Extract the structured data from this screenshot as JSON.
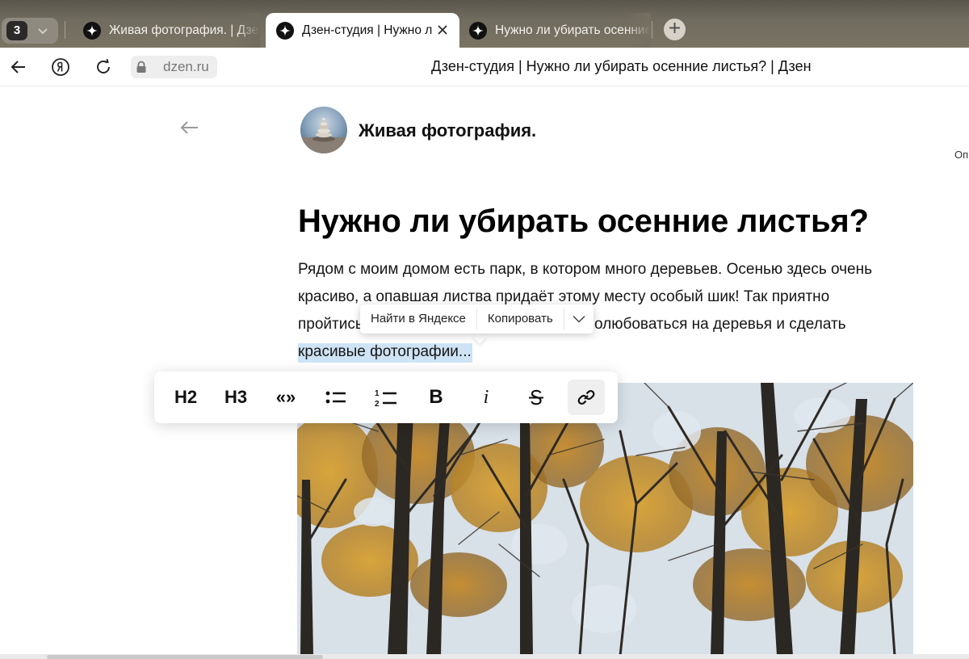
{
  "browser": {
    "tab_count": "3",
    "tabs": [
      {
        "title": "Живая фотография. | Дзен"
      },
      {
        "title": "Дзен-студия | Нужно ли убирать осенние листья? | Дзен"
      },
      {
        "title": "Нужно ли убирать осенние листья?"
      }
    ],
    "url": "dzen.ru",
    "page_title": "Дзен-студия | Нужно ли убирать осенние листья? | Дзен",
    "icons": [
      "back-arrow-icon",
      "yandex-logo-icon",
      "reload-icon",
      "lock-icon",
      "plus-icon",
      "close-icon",
      "zen-star-icon"
    ]
  },
  "editor": {
    "channel_name": "Живая фотография.",
    "side_text": "Оп",
    "headline": "Нужно ли убирать осенние листья?",
    "paragraph": {
      "line1": "Рядом с моим домом есть парк, в котором много деревьев. Осенью здесь очень",
      "line2": "красиво, а опавшая листва придаёт этому месту особый шик! Так приятно",
      "line3_start": "пройтись",
      "line3_end": "олюбоваться на деревья и сделать",
      "line4_selected": "красивые фотографии..."
    }
  },
  "context_menu": {
    "search": "Найти в Яндексе",
    "copy": "Копировать"
  },
  "format_toolbar": {
    "h2": "H2",
    "h3": "H3",
    "quote": "«»",
    "bold": "B",
    "italic": "i",
    "active_tool": "link"
  },
  "colors": {
    "tabstrip": "#6f6b5e",
    "selection": "#cfe3f6",
    "text": "#151515"
  }
}
